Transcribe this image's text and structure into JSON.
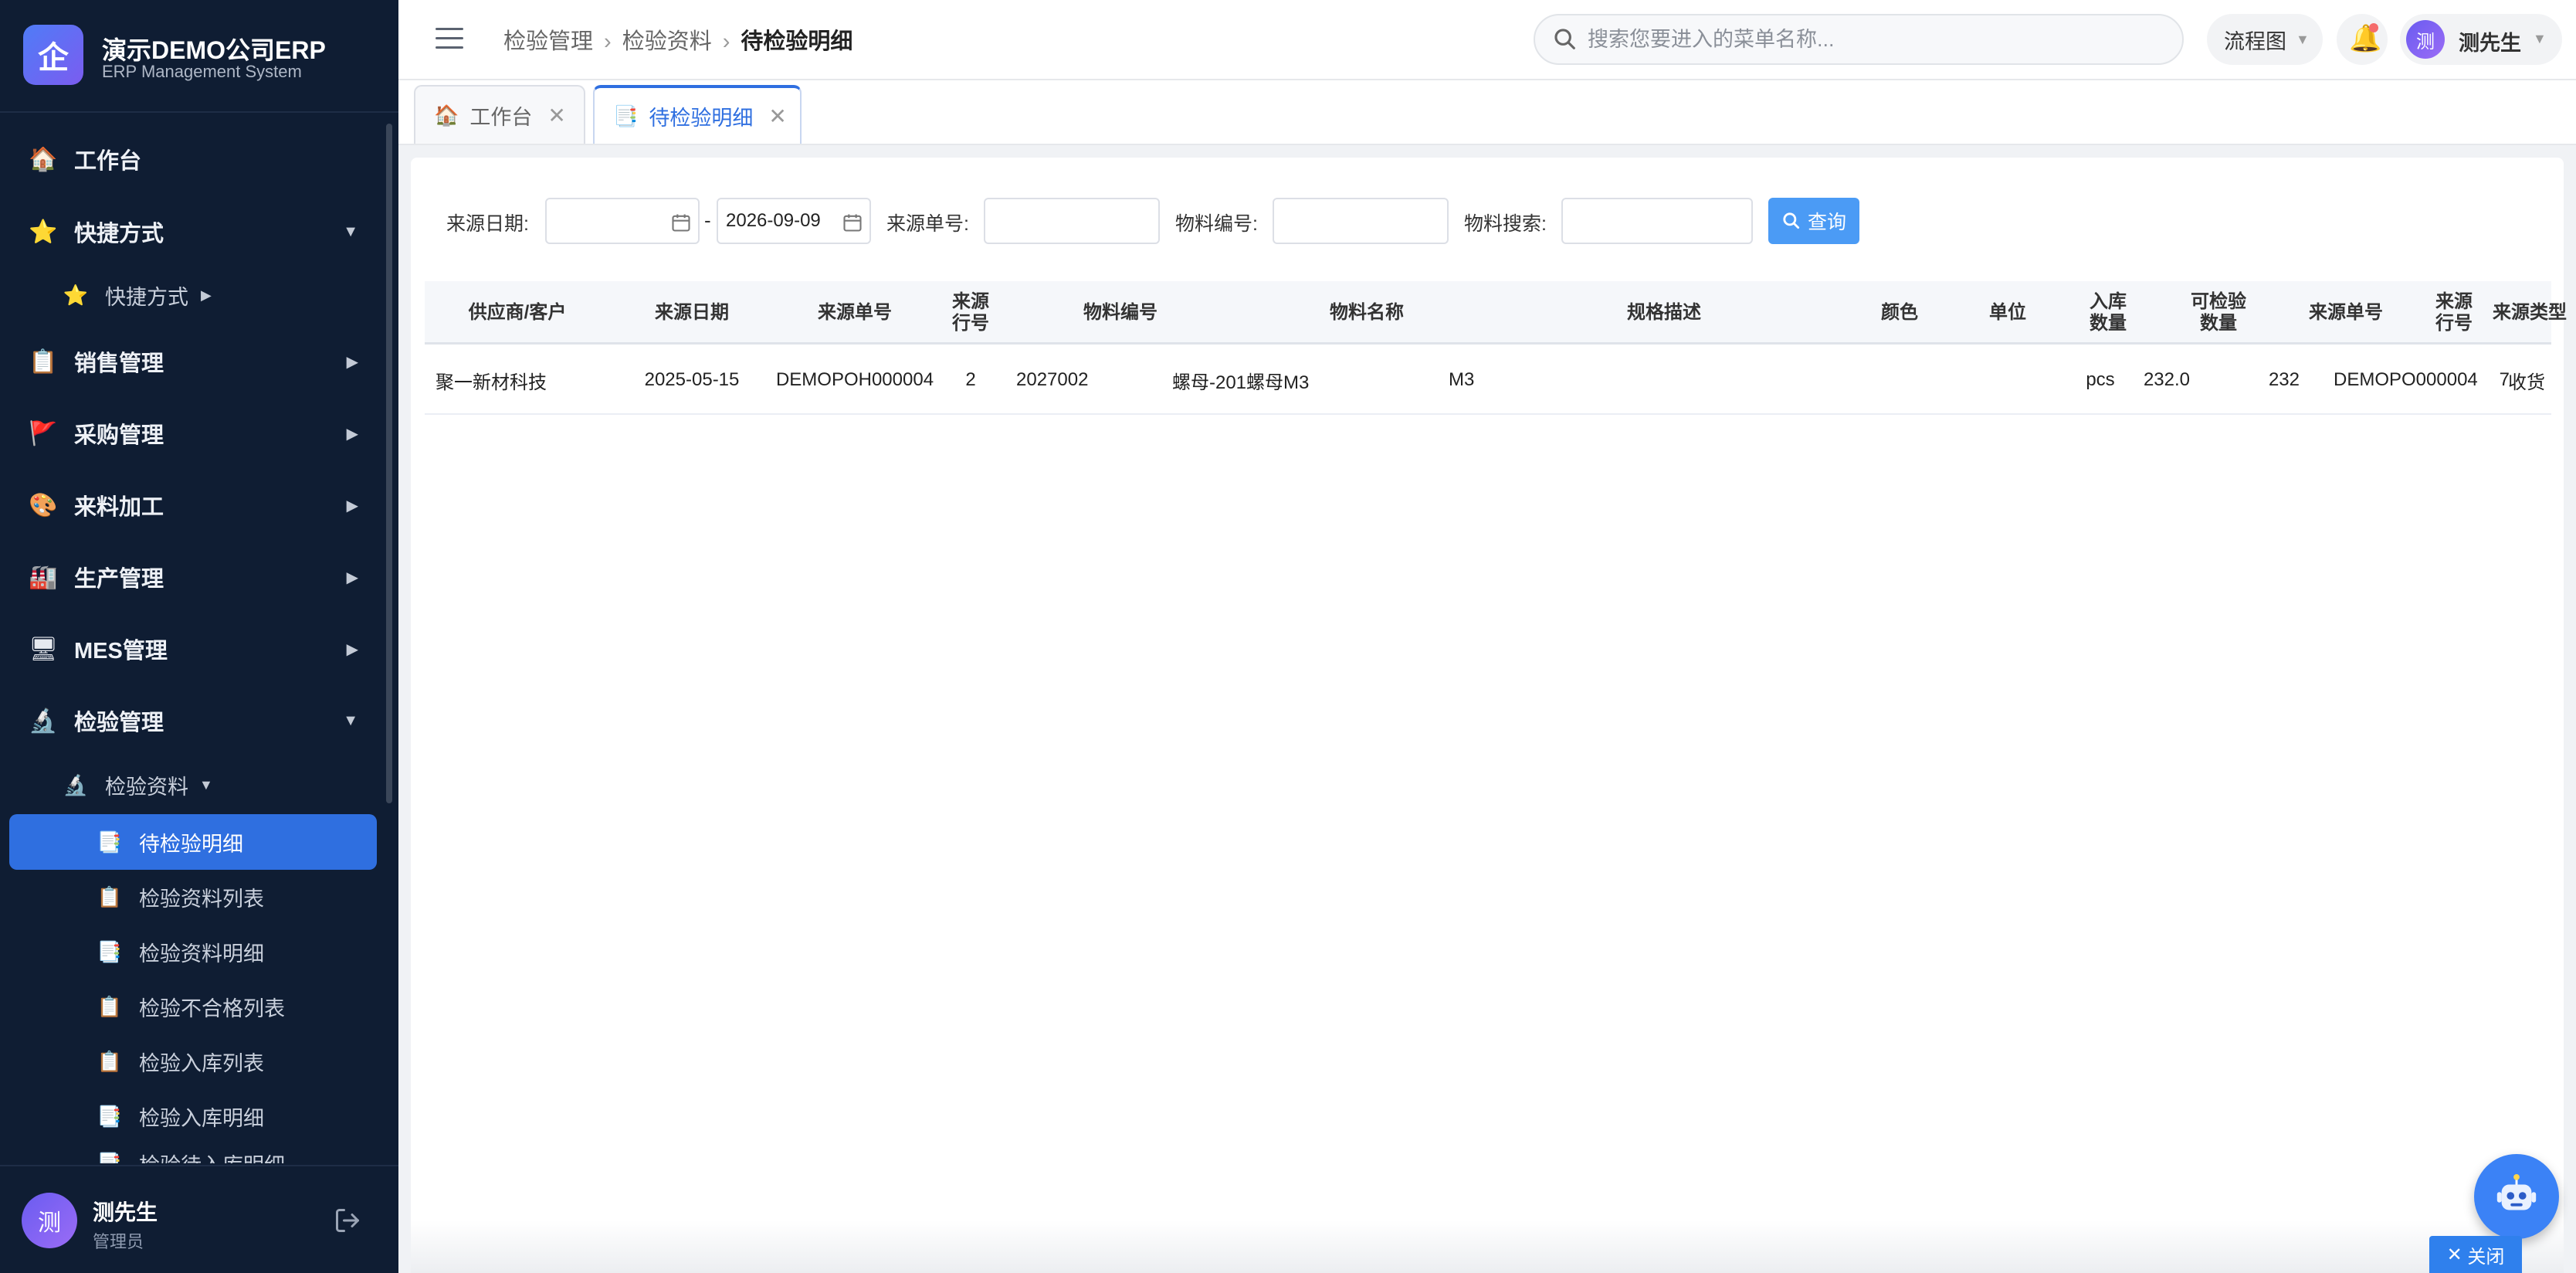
{
  "brand": {
    "logo_char": "企",
    "title": "演示DEMO公司ERP",
    "subtitle": "ERP Management System"
  },
  "sidebar": {
    "items": [
      {
        "icon": "🏠",
        "label": "工作台"
      },
      {
        "icon": "⭐",
        "label": "快捷方式",
        "arrow": "▼"
      },
      {
        "icon": "⭐",
        "label": "快捷方式",
        "arrow": "▶"
      },
      {
        "icon": "📋",
        "label": "销售管理",
        "arrow": "▶"
      },
      {
        "icon": "🚩",
        "label": "采购管理",
        "arrow": "▶"
      },
      {
        "icon": "🎨",
        "label": "来料加工",
        "arrow": "▶"
      },
      {
        "icon": "🏭",
        "label": "生产管理",
        "arrow": "▶"
      },
      {
        "icon": "🖥",
        "label": "MES管理",
        "arrow": "▶"
      },
      {
        "icon": "🔬",
        "label": "检验管理",
        "arrow": "▼"
      },
      {
        "icon": "🔬",
        "label": "检验资料",
        "arrow": "▼"
      },
      {
        "icon": "📑",
        "label": "待检验明细"
      },
      {
        "icon": "📋",
        "label": "检验资料列表"
      },
      {
        "icon": "📑",
        "label": "检验资料明细"
      },
      {
        "icon": "📋",
        "label": "检验不合格列表"
      },
      {
        "icon": "📋",
        "label": "检验入库列表"
      },
      {
        "icon": "📑",
        "label": "检验入库明细"
      },
      {
        "icon": "📑",
        "label": "检验待入库明细"
      }
    ],
    "user": {
      "avatar": "测",
      "name": "测先生",
      "role": "管理员"
    }
  },
  "topbar": {
    "breadcrumb": [
      "检验管理",
      "检验资料",
      "待检验明细"
    ],
    "separator": "›",
    "search_placeholder": "搜索您要进入的菜单名称...",
    "flow_label": "流程图",
    "dropdown_glyph": "▼",
    "bell_glyph": "🔔",
    "user_avatar": "测",
    "user_name": "测先生"
  },
  "tabs": [
    {
      "icon": "🏠",
      "label": "工作台",
      "close": "✕"
    },
    {
      "icon": "📑",
      "label": "待检验明细",
      "close": "✕"
    }
  ],
  "filter": {
    "date_label": "来源日期:",
    "date_start": "",
    "date_sep": "-",
    "date_end": "2026-09-09",
    "source_no_label": "来源单号:",
    "source_no_value": "",
    "material_code_label": "物料编号:",
    "material_code_value": "",
    "material_search_label": "物料搜索:",
    "material_search_value": "",
    "query_label": "查询"
  },
  "table": {
    "headers": [
      "供应商/客户",
      "来源日期",
      "来源单号",
      "来源\n行号",
      "物料编号",
      "物料名称",
      "规格描述",
      "颜色",
      "单位",
      "入库\n数量",
      "可检验\n数量",
      "来源单号",
      "来源\n行号",
      "来源类型"
    ],
    "rows": [
      [
        "聚一新材科技",
        "2025-05-15",
        "DEMOPOH000004",
        "2",
        "2027002",
        "螺母-201螺母M3",
        "M3",
        "",
        "pcs",
        "232.0",
        "232",
        "DEMOPO000004",
        "7",
        "收货"
      ]
    ]
  },
  "floating": {
    "close_label": "关闭",
    "close_glyph": "✕"
  },
  "colors": {
    "accent": "#2f6fe0",
    "sidebar_bg": "#0f1d33",
    "query_btn": "#4b9bf5"
  }
}
